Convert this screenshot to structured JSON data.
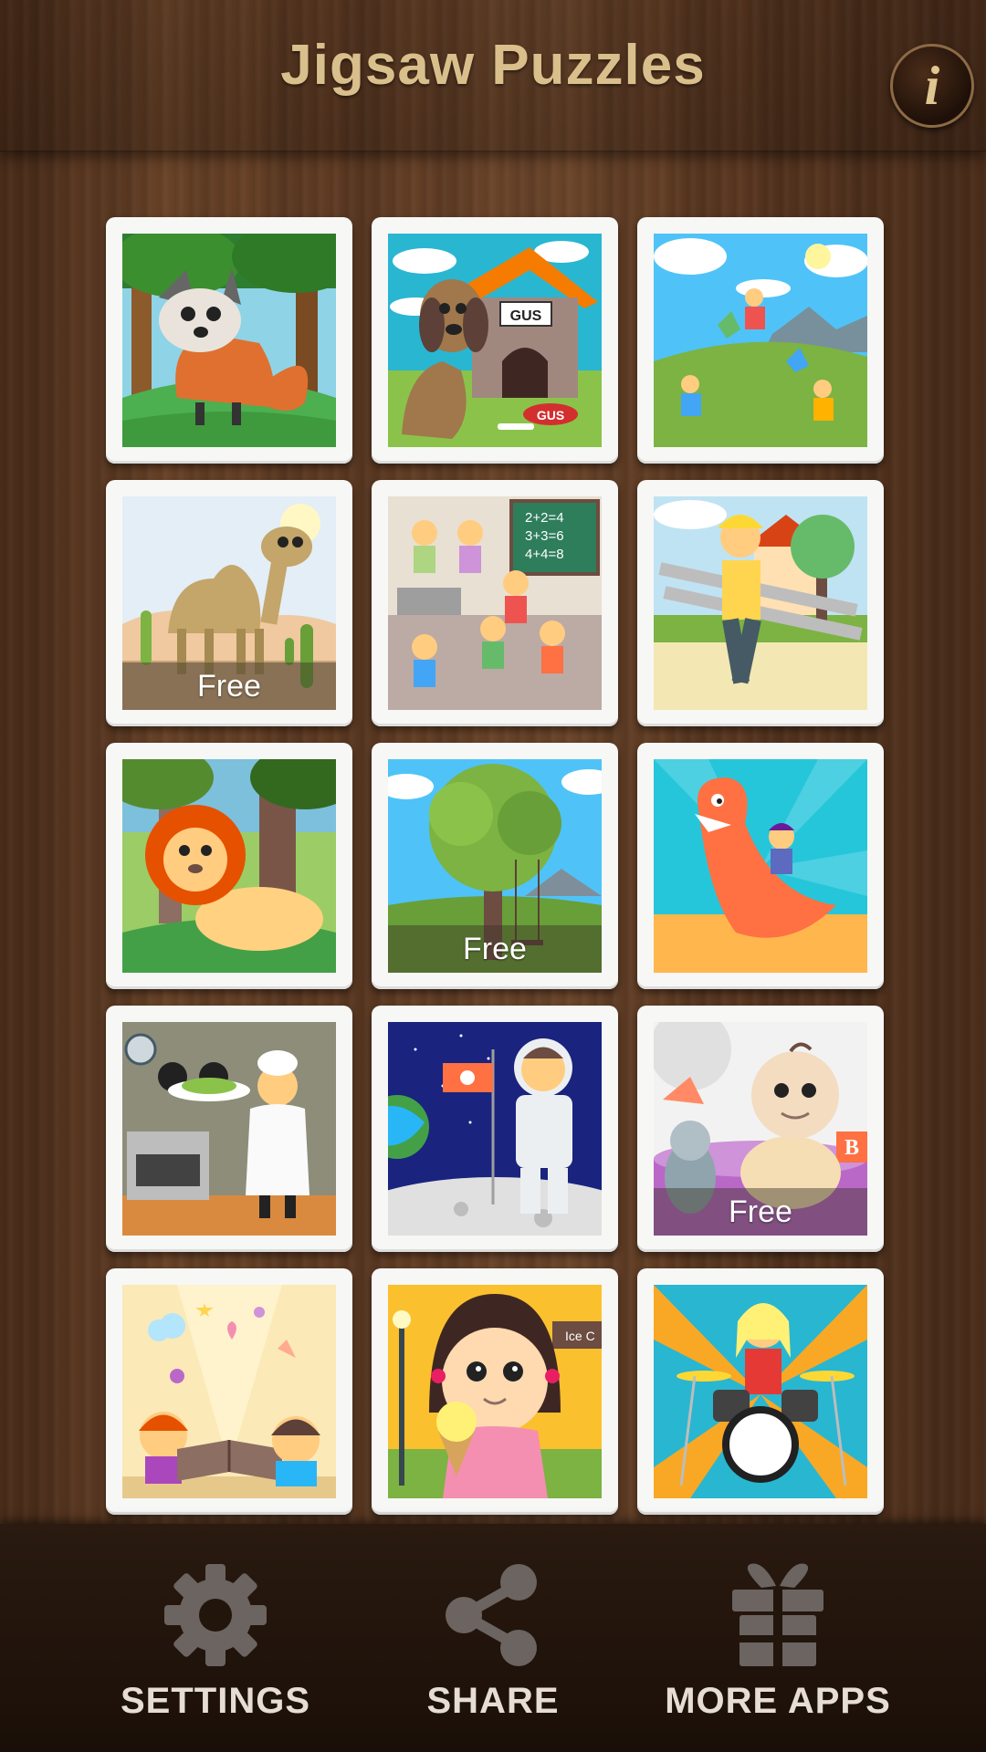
{
  "header": {
    "title": "Jigsaw Puzzles",
    "info_glyph": "i"
  },
  "puzzles": [
    {
      "subject": "fox in forest",
      "badge": ""
    },
    {
      "subject": "dog with doghouse",
      "badge": "",
      "sign_text": "GUS",
      "bowl_text": "GUS"
    },
    {
      "subject": "kids flying kites",
      "badge": ""
    },
    {
      "subject": "camel in desert",
      "badge": "Free"
    },
    {
      "subject": "kids at school",
      "badge": "",
      "board_lines": [
        "2+2=4",
        "3+3=6",
        "4+4=8"
      ]
    },
    {
      "subject": "builder with ladder",
      "badge": ""
    },
    {
      "subject": "lion in jungle",
      "badge": ""
    },
    {
      "subject": "tree with swing",
      "badge": "Free"
    },
    {
      "subject": "dinosaur with rider",
      "badge": ""
    },
    {
      "subject": "chef in kitchen",
      "badge": ""
    },
    {
      "subject": "astronaut on moon",
      "badge": ""
    },
    {
      "subject": "baby with toys",
      "badge": "Free",
      "block_letter": "B"
    },
    {
      "subject": "kids reading magic book",
      "badge": ""
    },
    {
      "subject": "girl with ice cream",
      "badge": "",
      "sign_text": "Ice C"
    },
    {
      "subject": "girl playing drums",
      "badge": ""
    }
  ],
  "bottom_bar": {
    "settings": {
      "label": "SETTINGS",
      "icon": "gear-icon"
    },
    "share": {
      "label": "SHARE",
      "icon": "share-icon"
    },
    "more_apps": {
      "label": "MORE APPS",
      "icon": "gift-icon"
    }
  },
  "colors": {
    "title": "#d9bf8b",
    "bar_icon": "#6b6461",
    "bar_label": "#e6ddd4"
  }
}
